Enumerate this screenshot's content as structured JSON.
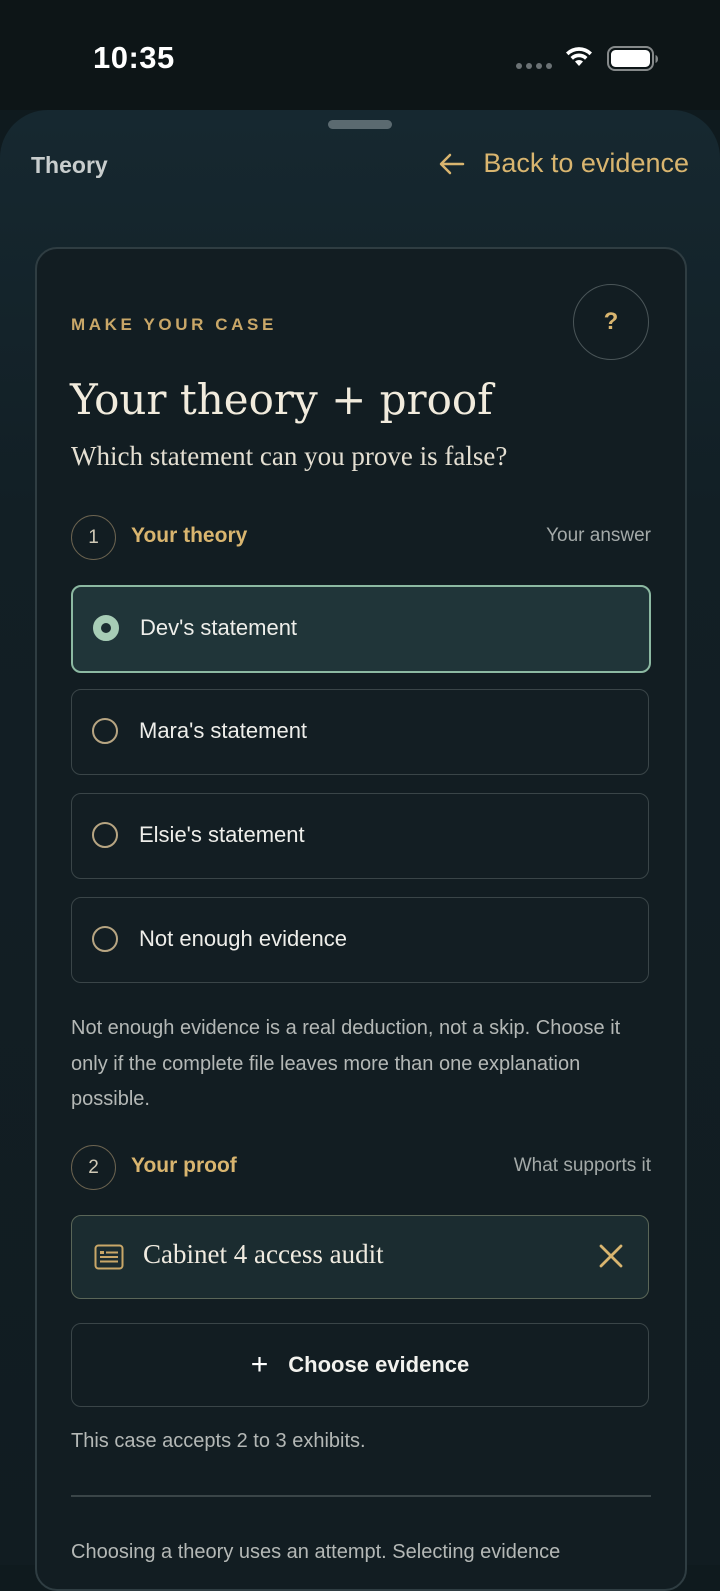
{
  "status_bar": {
    "time": "10:35"
  },
  "sheet": {
    "title": "Theory",
    "back_label": "Back to evidence"
  },
  "card": {
    "eyebrow": "MAKE YOUR CASE",
    "help_label": "?",
    "heading": "Your theory + proof",
    "subheading": "Which statement can you prove is false?",
    "theory_step": {
      "number": "1",
      "label": "Your theory",
      "hint": "Your answer"
    },
    "options": [
      {
        "label": "Dev's statement",
        "selected": true
      },
      {
        "label": "Mara's statement",
        "selected": false
      },
      {
        "label": "Elsie's statement",
        "selected": false
      },
      {
        "label": "Not enough evidence",
        "selected": false
      }
    ],
    "note": "Not enough evidence is a real deduction, not a skip. Choose it only if the complete file leaves more than one explanation possible.",
    "proof_step": {
      "number": "2",
      "label": "Your proof",
      "hint": "What supports it"
    },
    "selected_evidence": [
      {
        "label": "Cabinet 4 access audit",
        "icon": "document-icon"
      }
    ],
    "choose_evidence_label": "Choose evidence",
    "accepts_note": "This case accepts 2 to 3 exhibits.",
    "footer_note": "Choosing a theory uses an attempt. Selecting evidence"
  },
  "colors": {
    "accent": "#d9b56f",
    "selected_border": "#8cb9a2",
    "background": "#0f1a1e"
  }
}
